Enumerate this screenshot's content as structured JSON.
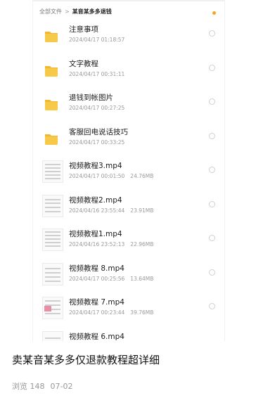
{
  "breadcrumb": {
    "root": "全部文件",
    "separator": ">",
    "current": "某音某多多退钱"
  },
  "files": [
    {
      "type": "folder",
      "name": "注意事项",
      "date": "2024/04/17 01:18:57",
      "size": ""
    },
    {
      "type": "folder",
      "name": "文字教程",
      "date": "2024/04/17 00:31:11",
      "size": ""
    },
    {
      "type": "folder",
      "name": "退钱到帐图片",
      "date": "2024/04/17 00:27:25",
      "size": ""
    },
    {
      "type": "folder",
      "name": "客服回电说话技巧",
      "date": "2024/04/17 00:33:25",
      "size": ""
    },
    {
      "type": "video",
      "name": "视频教程3.mp4",
      "date": "2024/04/17 00:01:50",
      "size": "24.76MB"
    },
    {
      "type": "video",
      "name": "视频教程2.mp4",
      "date": "2024/04/16 23:55:44",
      "size": "23.91MB"
    },
    {
      "type": "video",
      "name": "视频教程1.mp4",
      "date": "2024/04/16 23:52:13",
      "size": "22.96MB"
    },
    {
      "type": "video",
      "name": "视频教程 8.mp4",
      "date": "2024/04/17 00:25:56",
      "size": "13.64MB"
    },
    {
      "type": "video",
      "name": "视频教程 7.mp4",
      "date": "2024/04/17 00:23:44",
      "size": "39.76MB"
    },
    {
      "type": "video",
      "name": "视频教程 6.mp4",
      "date": "",
      "size": ""
    }
  ],
  "post": {
    "title": "卖某音某多多仅退款教程超详细",
    "views": "浏览 148",
    "date": "07-02"
  },
  "colors": {
    "folder": "#f7c948",
    "folder_tab": "#f2b72b",
    "accent": "#f5a623"
  },
  "icons": {
    "folder": "folder-icon",
    "video": "video-thumbnail"
  }
}
